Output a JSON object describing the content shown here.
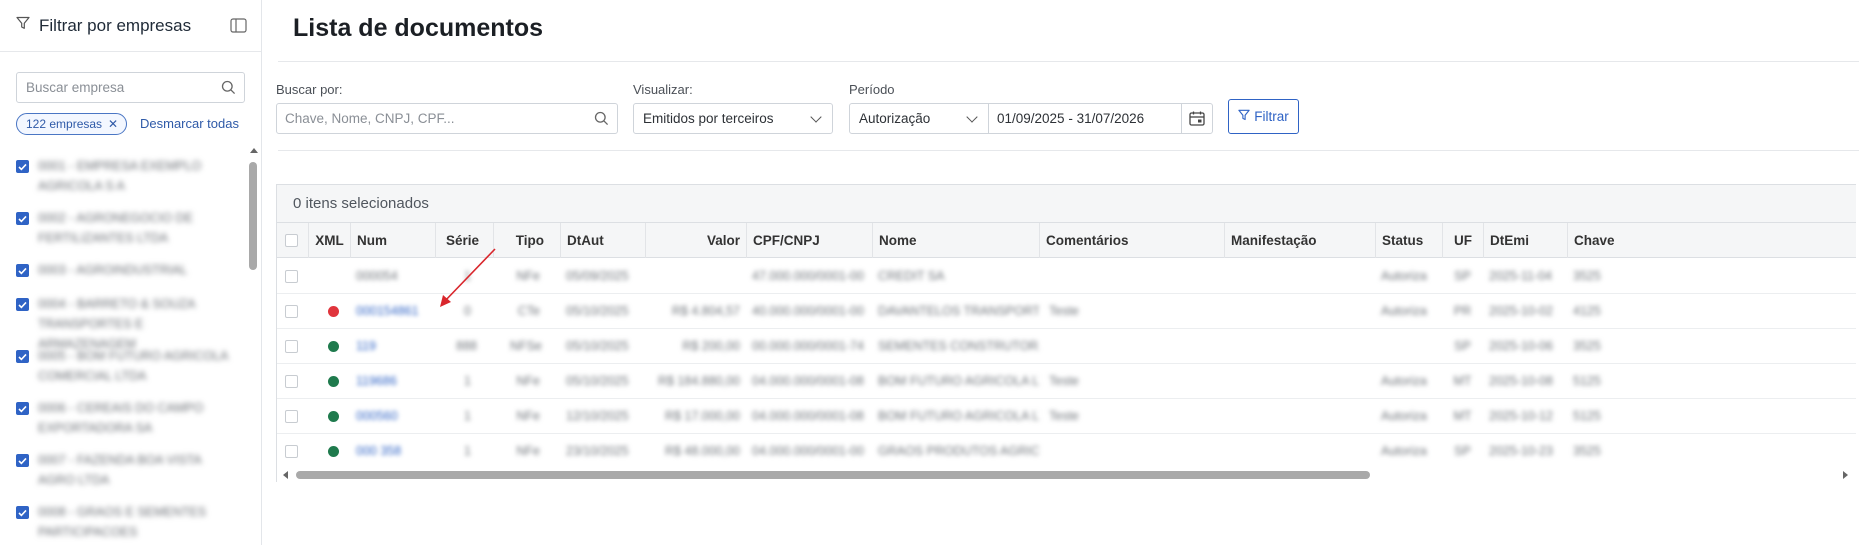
{
  "sidebar": {
    "title": "Filtrar por empresas",
    "search_placeholder": "Buscar empresa",
    "chip_label": "122 empresas",
    "chip_remove": "✕",
    "unselect_all": "Desmarcar todas",
    "companies": [
      {
        "name": "0001 - EMPRESA EXEMPLO AGRICOLA S A"
      },
      {
        "name": "0002 - AGRONEGOCIO DE FERTILIZANTES LTDA"
      },
      {
        "name": "0003 - AGROINDUSTRIAL"
      },
      {
        "name": "0004 - BARRETO & SOUZA TRANSPORTES E ARMAZENAGEM"
      },
      {
        "name": "0005 - BOM FUTURO AGRICOLA COMERCIAL LTDA"
      },
      {
        "name": "0006 - CEREAIS DO CAMPO EXPORTADORA SA"
      },
      {
        "name": "0007 - FAZENDA BOA VISTA AGRO LTDA"
      },
      {
        "name": "0008 - GRAOS E SEMENTES PARTICIPACOES"
      }
    ]
  },
  "main": {
    "title": "Lista de documentos",
    "search_label": "Buscar por:",
    "search_placeholder": "Chave, Nome, CNPJ, CPF...",
    "view_label": "Visualizar:",
    "view_value": "Emitidos por terceiros",
    "period_label": "Período",
    "period_type": "Autorização",
    "period_range": "01/09/2025 - 31/07/2026",
    "filter_button": "Filtrar"
  },
  "table": {
    "selected_count": "0 itens selecionados",
    "columns": [
      "XML",
      "Num",
      "Série",
      "Tipo",
      "DtAut",
      "Valor",
      "CPF/CNPJ",
      "Nome",
      "Comentários",
      "Manifestação",
      "Status",
      "UF",
      "DtEmi",
      "Chave"
    ],
    "rows": [
      {
        "xml": "",
        "num": "000054",
        "serie": "1",
        "tipo": "NFe",
        "dtaut": "05/09/2025",
        "valor": "",
        "cnpj": "47.000.000/0001-00",
        "nome": "CREDIT SA",
        "comentarios": "",
        "manif": "",
        "status": "Autoriza",
        "uf": "SP",
        "dtemi": "2025-11-04",
        "chave": "3525"
      },
      {
        "xml": "red",
        "num": "000154861",
        "serie": "0",
        "tipo": "CTe",
        "dtaut": "05/10/2025",
        "valor": "R$ 4.804,57",
        "cnpj": "40.000.000/0001-00",
        "nome": "DAVANTELOS TRANSPORTES LTDA",
        "comentarios": "Teste",
        "manif": "",
        "status": "Autoriza",
        "uf": "PR",
        "dtemi": "2025-10-02",
        "chave": "4125"
      },
      {
        "xml": "green",
        "num": "119",
        "serie": "888",
        "tipo": "NFSe",
        "dtaut": "05/10/2025",
        "valor": "R$ 200,00",
        "cnpj": "00.000.000/0001-74",
        "nome": "SEMENTES CONSTRUTORA LTDA",
        "comentarios": "",
        "manif": "",
        "status": "",
        "uf": "SP",
        "dtemi": "2025-10-06",
        "chave": "3525"
      },
      {
        "xml": "green",
        "num": "119686",
        "serie": "1",
        "tipo": "NFe",
        "dtaut": "05/10/2025",
        "valor": "R$ 184.880,00",
        "cnpj": "04.000.000/0001-08",
        "nome": "BOM FUTURO AGRICOLA LTDA",
        "comentarios": "Teste",
        "manif": "",
        "status": "Autoriza",
        "uf": "MT",
        "dtemi": "2025-10-08",
        "chave": "5125"
      },
      {
        "xml": "green",
        "num": "000560",
        "serie": "1",
        "tipo": "NFe",
        "dtaut": "12/10/2025",
        "valor": "R$ 17.000,00",
        "cnpj": "04.000.000/0001-08",
        "nome": "BOM FUTURO AGRICOLA LTDA",
        "comentarios": "Teste",
        "manif": "",
        "status": "Autoriza",
        "uf": "MT",
        "dtemi": "2025-10-12",
        "chave": "5125"
      },
      {
        "xml": "green",
        "num": "000 358",
        "serie": "1",
        "tipo": "NFe",
        "dtaut": "23/10/2025",
        "valor": "R$ 48.000,00",
        "cnpj": "04.000.000/0001-00",
        "nome": "GRAOS PRODUTOS AGRICOLAS",
        "comentarios": "",
        "manif": "",
        "status": "Autoriza",
        "uf": "SP",
        "dtemi": "2025-10-23",
        "chave": "3525"
      }
    ]
  },
  "colors": {
    "accent": "#2f63c5",
    "xml_ok": "#1f7a4d",
    "xml_error": "#e0343c",
    "annotation_arrow": "#d9262c"
  }
}
